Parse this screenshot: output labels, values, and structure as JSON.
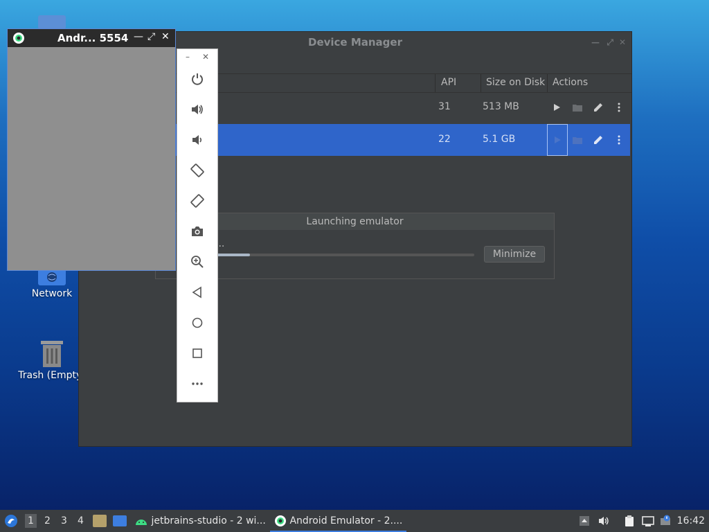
{
  "desktop": {
    "icons": [
      {
        "label": "Network"
      },
      {
        "label": "Trash (Empty)"
      }
    ]
  },
  "device_manager": {
    "title": "Device Manager",
    "columns": {
      "api": "API",
      "size": "Size on Disk",
      "actions": "Actions"
    },
    "rows": [
      {
        "api": "31",
        "size": "513 MB"
      },
      {
        "api": "22",
        "size": "5.1 GB"
      }
    ]
  },
  "launch_dialog": {
    "title": "Launching emulator",
    "message": "...",
    "progress_percent": 13,
    "minimize_label": "Minimize"
  },
  "emulator_window": {
    "title": "Andr... 5554"
  },
  "taskbar": {
    "workspaces": [
      "1",
      "2",
      "3",
      "4"
    ],
    "tasks": [
      {
        "label": "jetbrains-studio - 2 wi..."
      },
      {
        "label": "Android Emulator - 2...."
      }
    ],
    "clock": "16:42"
  },
  "colors": {
    "selection": "#2f65ca",
    "window_bg": "#3c3f41",
    "taskbar_bg": "#3a3d40",
    "accent": "#3d7ee0"
  }
}
